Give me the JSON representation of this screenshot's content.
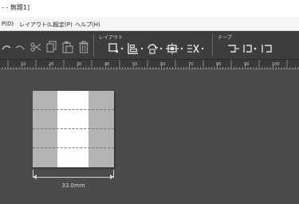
{
  "window": {
    "title": "- - 無題1]"
  },
  "menu": [
    {
      "label": "P(D)"
    },
    {
      "label": "レイアウト(L)"
    },
    {
      "label": "設定(P)"
    },
    {
      "label": "ヘルプ(H)"
    }
  ],
  "toolbar": {
    "layout_group_label": "レイアウト",
    "tape_group_label": "テープ",
    "icons": [
      "undo-icon",
      "redo-icon",
      "cut-icon",
      "copy-icon",
      "paste-icon",
      "delete-icon",
      "frame-icon",
      "align-icon",
      "rotate-icon",
      "distribute-icon",
      "no-arrange-icon",
      "tape-left-icon",
      "tape-center-icon",
      "tape-right-icon"
    ]
  },
  "ruler": {
    "labels": [
      "10",
      "20",
      "30",
      "40",
      "50",
      "60",
      "70",
      "80",
      "90",
      "100"
    ]
  },
  "canvas": {
    "tape_length_label": "33.0mm",
    "colors": {
      "canvas": "#4b4b4b",
      "tape": "#b3b3b3",
      "print_area": "#ffffff"
    }
  }
}
